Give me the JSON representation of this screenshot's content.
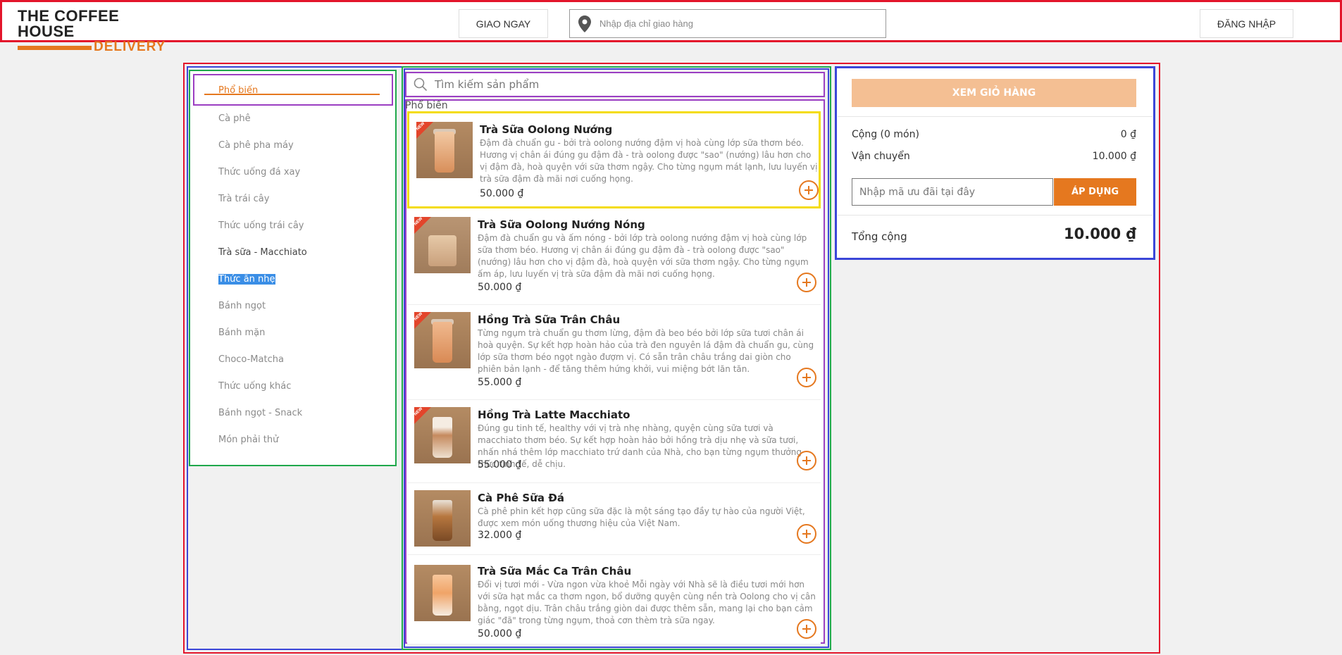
{
  "header": {
    "logo_top": "THE COFFEE HOUSE",
    "logo_bottom": "DELIVERY",
    "delivery_button": "GIAO NGAY",
    "address_placeholder": "Nhập địa chỉ giao hàng",
    "login_button": "ĐĂNG NHẬP"
  },
  "sidebar": {
    "items": [
      {
        "label": "Phổ biến"
      },
      {
        "label": "Cà phê"
      },
      {
        "label": "Cà phê pha máy"
      },
      {
        "label": "Thức uống đá xay"
      },
      {
        "label": "Trà trái cây"
      },
      {
        "label": "Thức uống trái cây"
      },
      {
        "label": "Trà sữa - Macchiato"
      },
      {
        "label": "Thức ăn nhẹ"
      },
      {
        "label": "Bánh ngọt"
      },
      {
        "label": "Bánh mặn"
      },
      {
        "label": "Choco-Matcha"
      },
      {
        "label": "Thức uống khác"
      },
      {
        "label": "Bánh ngọt - Snack"
      },
      {
        "label": "Món phải thử"
      }
    ]
  },
  "search": {
    "placeholder": "Tìm kiếm sản phẩm"
  },
  "section_title": "Phổ biến",
  "products": [
    {
      "name": "Trà Sữa Oolong Nướng",
      "desc": "Đậm đà chuẩn gu - bởi trà oolong nướng đậm vị hoà cùng lớp sữa thơm béo. Hương vị chân ái đúng gu đậm đà - trà oolong được \"sao\" (nướng) lâu hơn cho vị đậm đà, hoà quyện với sữa thơm ngậy. Cho từng ngụm mát lạnh, lưu luyến vị trà sữa đậm đà mãi nơi cuống họng.",
      "price": "50.000 ₫",
      "badge": "NEW"
    },
    {
      "name": "Trà Sữa Oolong Nướng Nóng",
      "desc": "Đậm đà chuẩn gu và ấm nóng - bởi lớp trà oolong nướng đậm vị hoà cùng lớp sữa thơm béo. Hương vị chân ái đúng gu đậm đà - trà oolong được \"sao\" (nướng) lâu hơn cho vị đậm đà, hoà quyện với sữa thơm ngậy. Cho từng ngụm ấm áp, lưu luyến vị trà sữa đậm đà mãi nơi cuống họng.",
      "price": "50.000 ₫",
      "badge": "NEW"
    },
    {
      "name": "Hồng Trà Sữa Trân Châu",
      "desc": "Từng ngụm trà chuẩn gu thơm lừng, đậm đà beo béo bởi lớp sữa tươi chân ái hoà quyện. Sự kết hợp hoàn hảo của trà đen nguyên lá đậm đà chuẩn gu, cùng lớp sữa thơm béo ngọt ngào đượm vị. Có sẵn trân châu trắng dai giòn cho phiên bản lạnh - để tăng thêm hứng khởi, vui miệng bớt lăn tăn.",
      "price": "55.000 ₫",
      "badge": "NEW"
    },
    {
      "name": "Hồng Trà Latte Macchiato",
      "desc": "Đúng gu tinh tế, healthy với vị trà nhẹ nhàng, quyện cùng sữa tươi và macchiato thơm béo. Sự kết hợp hoàn hảo bởi hồng trà dịu nhẹ và sữa tươi, nhấn nhá thêm lớp macchiato trứ danh của Nhà, cho bạn từng ngụm thưởng thức tinh tế, dễ chịu.",
      "price": "55.000 ₫",
      "badge": "NEW"
    },
    {
      "name": "Cà Phê Sữa Đá",
      "desc": "Cà phê phin kết hợp cũng sữa đặc là một sáng tạo đầy tự hào của người Việt, được xem món uống thương hiệu của Việt Nam.",
      "price": "32.000 ₫",
      "badge": ""
    },
    {
      "name": "Trà Sữa Mắc Ca Trân Châu",
      "desc": "Đổi vị tươi mới - Vừa ngon vừa khoẻ Mỗi ngày với Nhà sẽ là điều tươi mới hơn với sữa hạt mắc ca thơm ngon, bổ dưỡng quyện cùng nền trà Oolong cho vị cân bằng, ngọt dịu. Trân châu trắng giòn dai được thêm sẵn, mang lại cho bạn cảm giác \"đã\" trong từng ngụm, thoả cơn thèm trà sữa ngay.",
      "price": "50.000 ₫",
      "badge": ""
    }
  ],
  "cart": {
    "view_cart_button": "XEM GIỎ HÀNG",
    "subtotal_label": "Cộng (0 món)",
    "subtotal_value": "0 ₫",
    "shipping_label": "Vận chuyển",
    "shipping_value": "10.000 ₫",
    "coupon_placeholder": "Nhập mã ưu đãi tại đây",
    "apply_button": "ÁP DỤNG",
    "total_label": "Tổng cộng",
    "total_value": "10.000 ₫"
  },
  "colors": {
    "accent": "#e5781f",
    "accent_light": "#f4bf93"
  }
}
